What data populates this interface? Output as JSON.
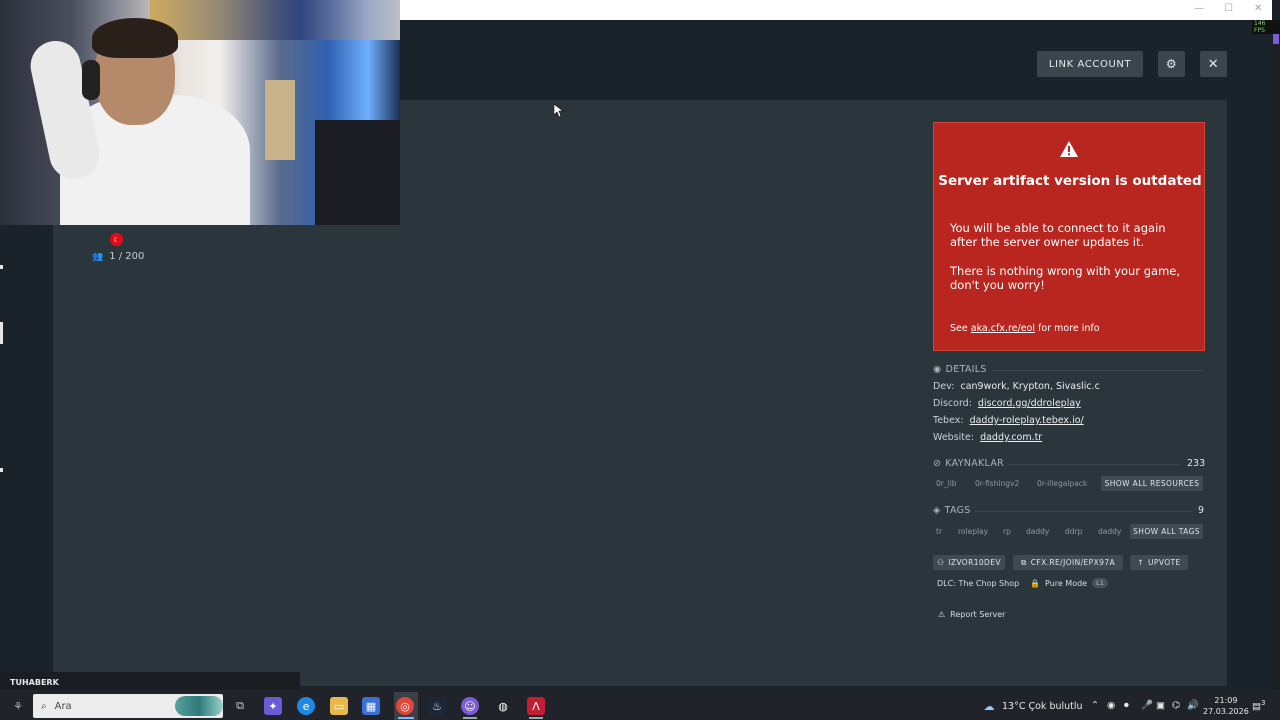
{
  "header": {
    "link_account": "LINK ACCOUNT",
    "gear_symbol": "⚙",
    "close_symbol": "✕"
  },
  "server": {
    "flag_label": "☾",
    "players": "1 / 200"
  },
  "warning": {
    "title": "Server artifact version is outdated",
    "p1": "You will be able to connect to it again after the server owner updates it.",
    "p2": "There is nothing wrong with your game, don't you worry!",
    "more_prefix": "See",
    "more_link": "aka.cfx.re/eol",
    "more_suffix": "for more info",
    "color": "#b8261f"
  },
  "details": {
    "title": "DETAILS",
    "dev_label": "Dev:",
    "dev_value": "can9work, Krypton, Sivaslic.c",
    "discord_label": "Discord:",
    "discord_value": "discord.gg/ddroleplay",
    "tebex_label": "Tebex:",
    "tebex_value": "daddy-roleplay.tebex.io/",
    "website_label": "Website:",
    "website_value": "daddy.com.tr"
  },
  "resources": {
    "title": "KAYNAKLAR",
    "count": "233",
    "items": [
      "0r_lib",
      "0r-fishingv2",
      "0r-illegalpack"
    ],
    "show_all": "SHOW ALL RESOURCES"
  },
  "tags": {
    "title": "TAGS",
    "count": "9",
    "items": [
      "tr",
      "roleplay",
      "rp",
      "daddy",
      "ddrp",
      "daddy"
    ],
    "show_all": "SHOW ALL TAGS"
  },
  "actions": {
    "owner": "IZVOR10DEV",
    "join": "CFX.RE/JOIN/EPX97A",
    "upvote": "UPVOTE",
    "dlc": "DLC: The Chop Shop",
    "pure_mode": "Pure Mode",
    "pure_level": "L1",
    "report": "Report Server"
  },
  "overlay": {
    "fps": "146 FPS",
    "streamer": "TUHABERK"
  },
  "taskbar": {
    "search_placeholder": "Ara",
    "weather": "13°C  Çok bulutlu",
    "time": "21:09",
    "date": "27.03.2026",
    "notif_count": "3"
  }
}
